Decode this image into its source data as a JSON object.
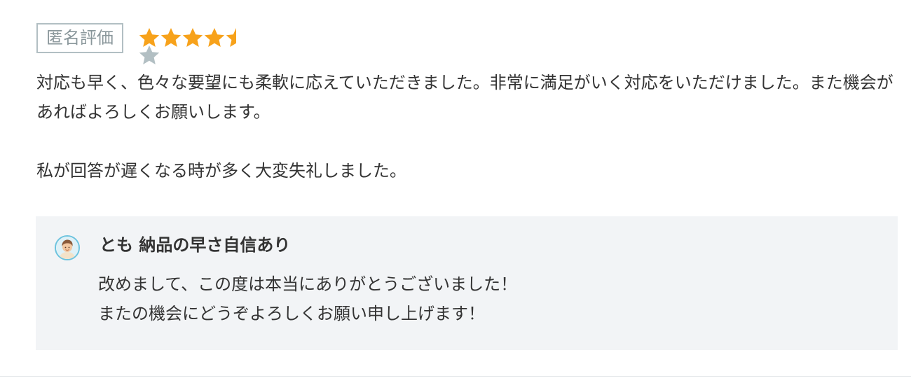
{
  "review": {
    "badge_label": "匿名評価",
    "rating": 4.5,
    "rating_max": 5,
    "colors": {
      "star_filled": "#f7a21b",
      "star_empty": "#b2bfc3"
    },
    "paragraphs": [
      "対応も早く、色々な要望にも柔軟に応えていただきました。非常に満足がいく対応をいただけました。また機会があればよろしくお願いします。",
      "私が回答が遅くなる時が多く大変失礼しました。"
    ]
  },
  "reply": {
    "author_name": "とも 納品の早さ自信あり",
    "avatar_icon": "user-avatar-icon",
    "lines": [
      "改めまして、この度は本当にありがとうございました！",
      "またの機会にどうぞよろしくお願い申し上げます！"
    ],
    "background_color": "#f2f4f6"
  }
}
